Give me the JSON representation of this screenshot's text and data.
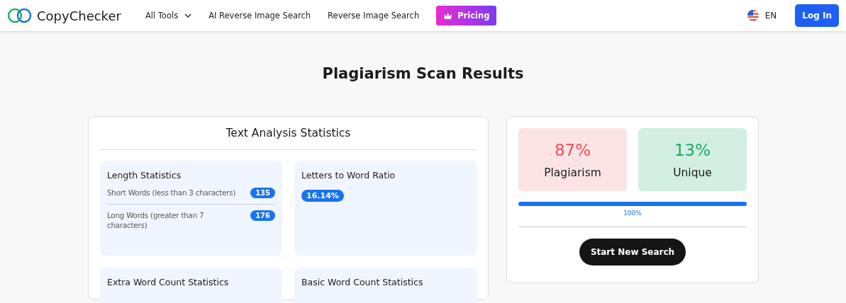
{
  "header": {
    "brand": "CopyChecker",
    "nav": [
      {
        "label": "All Tools",
        "kind": "dropdown"
      },
      {
        "label": "AI Reverse Image Search",
        "kind": "link"
      },
      {
        "label": "Reverse Image Search",
        "kind": "link"
      },
      {
        "label": "Pricing",
        "kind": "premium"
      }
    ],
    "language": "EN",
    "login": "Log In"
  },
  "title": "Plagiarism Scan Results",
  "analysis": {
    "title": "Text Analysis Statistics",
    "cards": [
      {
        "title": "Length Statistics",
        "kind": "list",
        "items": [
          {
            "label": "Short Words (less than 3 characters)",
            "value": "135"
          },
          {
            "label": "Long Words (greater than 7 characters)",
            "value": "176"
          }
        ]
      },
      {
        "title": "Letters to Word Ratio",
        "kind": "single",
        "value": "16.14%"
      },
      {
        "title": "Extra Word Count Statistics",
        "kind": "list"
      },
      {
        "title": "Basic Word Count Statistics",
        "kind": "list"
      }
    ]
  },
  "results": {
    "tiles": [
      {
        "value": "87%",
        "label": "Plagiarism",
        "kind": "plagiarism"
      },
      {
        "value": "13%",
        "label": "Unique",
        "kind": "unique"
      }
    ],
    "progress": {
      "level": 1.0,
      "reading": "100%"
    },
    "button": "Start New Search"
  }
}
